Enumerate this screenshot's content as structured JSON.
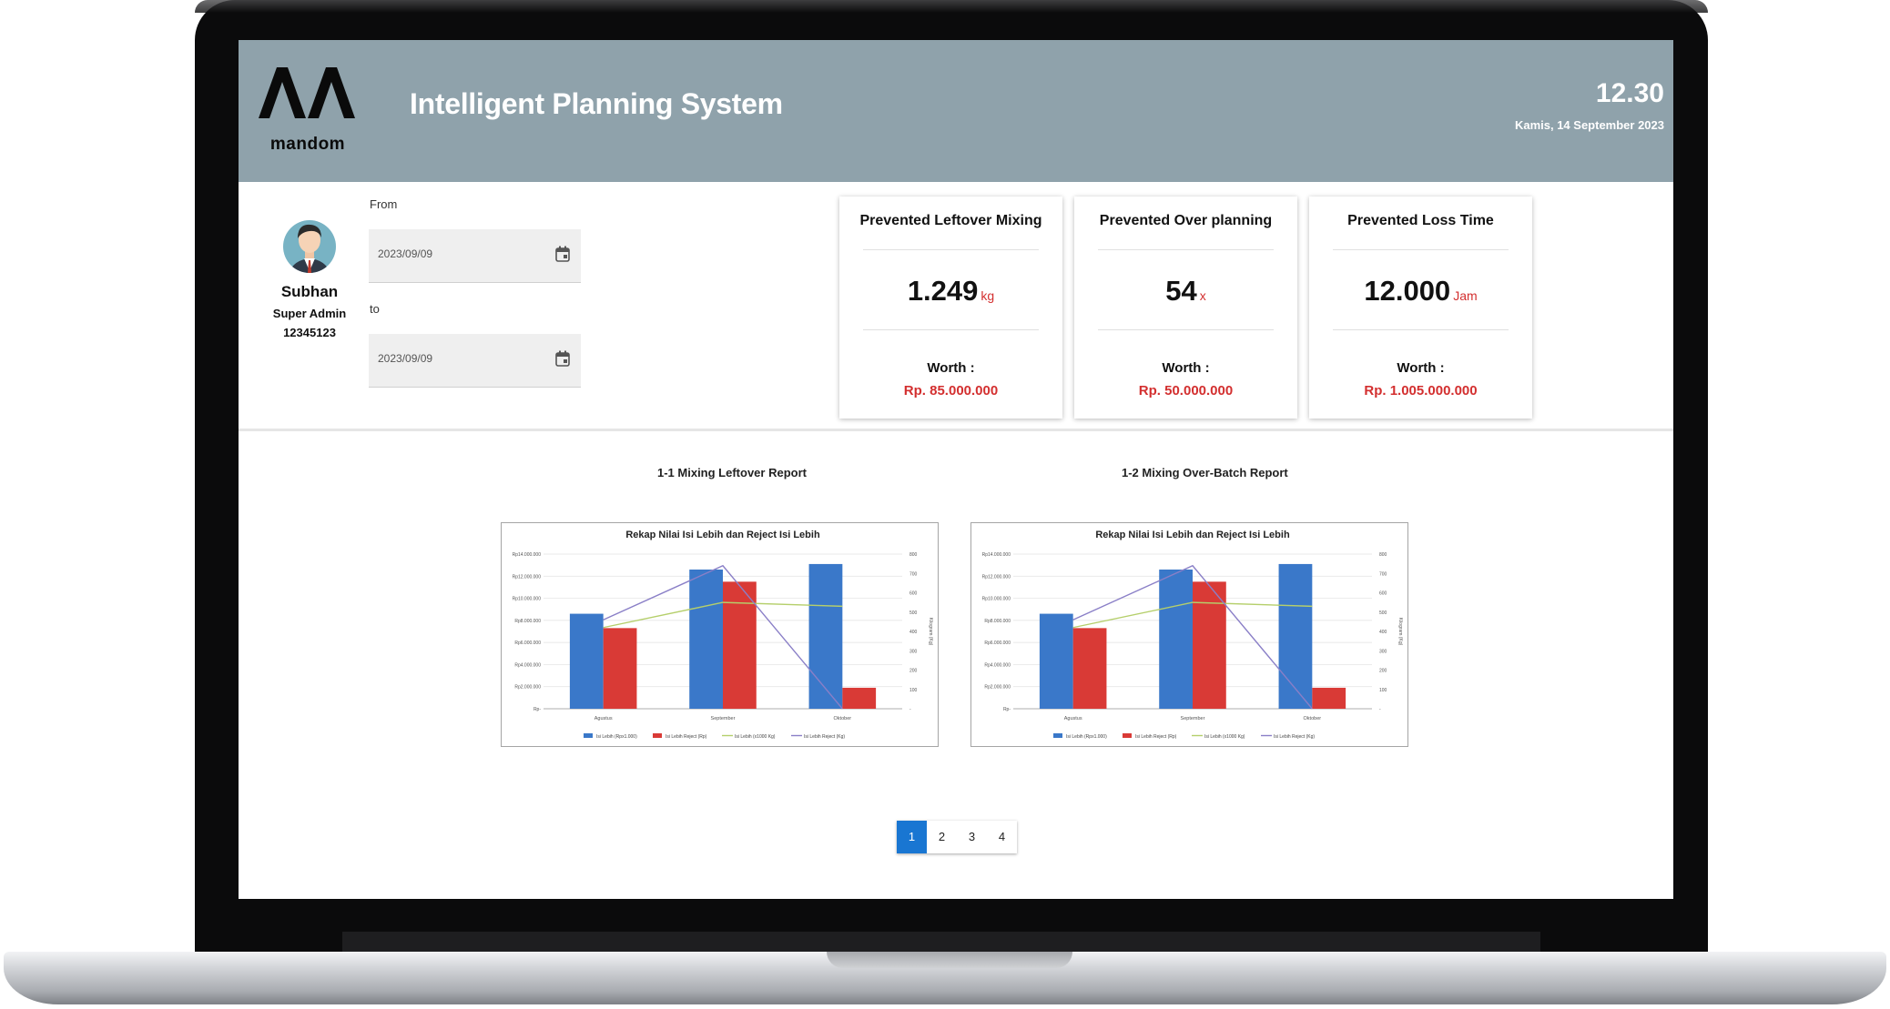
{
  "header": {
    "logo_text": "mandom",
    "title": "Intelligent Planning System",
    "time": "12.30",
    "date": "Kamis, 14 September 2023"
  },
  "user": {
    "name": "Subhan",
    "role": "Super Admin",
    "id": "12345123"
  },
  "filters": {
    "from_label": "From",
    "from_value": "2023/09/09",
    "to_label": "to",
    "to_value": "2023/09/09"
  },
  "cards": [
    {
      "title": "Prevented Leftover Mixing",
      "value": "1.249",
      "unit": "kg",
      "worth_label": "Worth :",
      "worth": "Rp. 85.000.000"
    },
    {
      "title": "Prevented Over planning",
      "value": "54",
      "unit": "x",
      "worth_label": "Worth :",
      "worth": "Rp. 50.000.000"
    },
    {
      "title": "Prevented Loss Time",
      "value": "12.000",
      "unit": "Jam",
      "worth_label": "Worth :",
      "worth": "Rp. 1.005.000.000"
    }
  ],
  "reports": [
    {
      "label": "1-1 Mixing Leftover Report"
    },
    {
      "label": "1-2 Mixing Over-Batch Report"
    }
  ],
  "pagination": {
    "pages": [
      "1",
      "2",
      "3",
      "4"
    ],
    "active": 0
  },
  "colors": {
    "header_bg": "#8fa2ab",
    "accent_red": "#d32f2f",
    "page_active": "#1976d2",
    "bar_blue": "#3a78c9",
    "bar_red": "#d93a36",
    "line_green": "#b5cf6b",
    "line_purple": "#8a7fc7"
  },
  "chart_data": [
    {
      "type": "bar",
      "title": "Rekap Nilai Isi Lebih dan Reject Isi Lebih",
      "categories": [
        "Agustus",
        "September",
        "Oktober"
      ],
      "ylim": [
        0,
        14000000
      ],
      "y_ticks": [
        "Rp-",
        "Rp2.000.000",
        "Rp4.000.000",
        "Rp6.000.000",
        "Rp8.000.000",
        "Rp10.000.000",
        "Rp12.000.000",
        "Rp14.000.000"
      ],
      "y2lim": [
        0,
        800
      ],
      "y2_ticks": [
        "-",
        "100",
        "200",
        "300",
        "400",
        "500",
        "600",
        "700",
        "800"
      ],
      "y2label": "Kilogram (Kg)",
      "legend_position": "bottom",
      "series": [
        {
          "name": "Isi Lebih (Rpx1.000)",
          "kind": "bar",
          "axis": "left",
          "values": [
            8600000,
            12600000,
            13100000
          ]
        },
        {
          "name": "Isi Lebih Reject (Rp)",
          "kind": "bar",
          "axis": "left",
          "values": [
            7300000,
            11500000,
            1900000
          ]
        },
        {
          "name": "Isi Lebih (x1000 Kg)",
          "kind": "line",
          "axis": "right",
          "values": [
            420,
            550,
            530
          ]
        },
        {
          "name": "Isi Lebih Reject (Kg)",
          "kind": "line",
          "axis": "right",
          "values": [
            460,
            740,
            0
          ]
        }
      ]
    },
    {
      "type": "bar",
      "title": "Rekap Nilai Isi Lebih dan Reject Isi Lebih",
      "categories": [
        "Agustus",
        "September",
        "Oktober"
      ],
      "ylim": [
        0,
        14000000
      ],
      "y_ticks": [
        "Rp-",
        "Rp2.000.000",
        "Rp4.000.000",
        "Rp6.000.000",
        "Rp8.000.000",
        "Rp10.000.000",
        "Rp12.000.000",
        "Rp14.000.000"
      ],
      "y2lim": [
        0,
        800
      ],
      "y2_ticks": [
        "-",
        "100",
        "200",
        "300",
        "400",
        "500",
        "600",
        "700",
        "800"
      ],
      "y2label": "Kilogram (Kg)",
      "legend_position": "bottom",
      "series": [
        {
          "name": "Isi Lebih (Rpx1.000)",
          "kind": "bar",
          "axis": "left",
          "values": [
            8600000,
            12600000,
            13100000
          ]
        },
        {
          "name": "Isi Lebih Reject (Rp)",
          "kind": "bar",
          "axis": "left",
          "values": [
            7300000,
            11500000,
            1900000
          ]
        },
        {
          "name": "Isi Lebih (x1000 Kg)",
          "kind": "line",
          "axis": "right",
          "values": [
            420,
            550,
            530
          ]
        },
        {
          "name": "Isi Lebih Reject (Kg)",
          "kind": "line",
          "axis": "right",
          "values": [
            460,
            740,
            0
          ]
        }
      ]
    }
  ]
}
